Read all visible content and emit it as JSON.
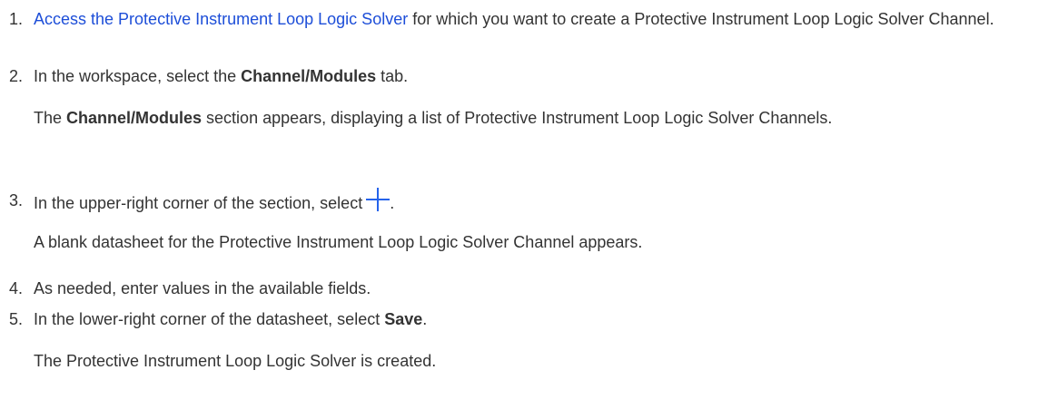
{
  "steps": [
    {
      "number": "1.",
      "link": "Access the Protective Instrument Loop Logic Solver",
      "text": " for which you want to create a Protective Instrument Loop Logic Solver Channel."
    },
    {
      "number": "2.",
      "pre": "In the workspace, select the ",
      "bold": "Channel/Modules",
      "post": " tab.",
      "result_pre": "The ",
      "result_bold": "Channel/Modules",
      "result_post": " section appears, displaying a list of Protective Instrument Loop Logic Solver Channels."
    },
    {
      "number": "3.",
      "pre": "In the upper-right corner of the section, select",
      "icon": "plus-icon",
      "post": ".",
      "result": "A blank datasheet for the Protective Instrument Loop Logic Solver Channel appears."
    },
    {
      "number": "4.",
      "text": "As needed, enter values in the available fields."
    },
    {
      "number": "5.",
      "pre": "In the lower-right corner of the datasheet, select ",
      "bold": "Save",
      "post": ".",
      "result": "The Protective Instrument Loop Logic Solver is created."
    }
  ],
  "colors": {
    "text": "#333333",
    "link": "#1d4ed8",
    "icon": "#2563eb"
  }
}
